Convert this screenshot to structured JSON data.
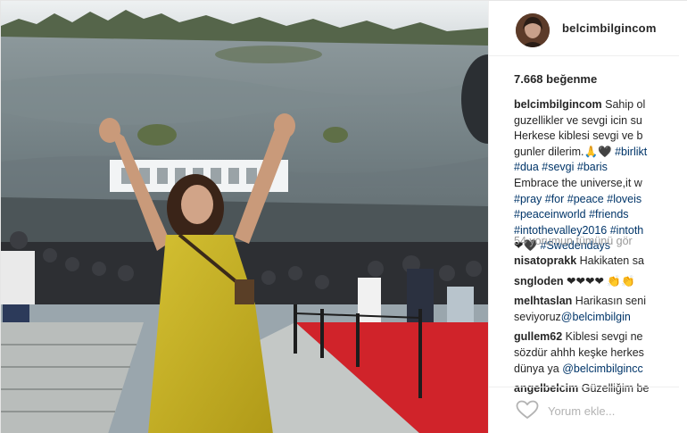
{
  "post": {
    "username": "belcimbilgincom",
    "likes": "7.668 beğenme",
    "caption_lines": [
      {
        "user": "belcimbilgincom",
        "text": " Sahip ol"
      },
      {
        "text": "guzellikler ve sevgi icin su"
      },
      {
        "text": "Herkese kiblesi sevgi ve b"
      },
      {
        "text": "gunler dilerim.🙏🖤 ",
        "tag": "#birlikt"
      },
      {
        "tag": "#dua #sevgi #baris"
      },
      {
        "text": "Embrace the universe,it w"
      },
      {
        "tag": "#pray #for #peace #loveis"
      },
      {
        "tag": "#peaceinworld #friends"
      },
      {
        "tag": "#intothevalley2016 #intoth"
      },
      {
        "text": "❤🖤 ",
        "tag": "#Swedendays"
      }
    ],
    "view_all": "54 yorumun tümünü gör",
    "comments": [
      {
        "lines": [
          {
            "user": "nisatoprakk",
            "text": " Hakikaten sa"
          }
        ]
      },
      {
        "lines": [
          {
            "user": "sngloden",
            "text": " ❤❤❤❤ 👏👏"
          }
        ]
      },
      {
        "lines": [
          {
            "user": "melhtaslan",
            "text": " Harikasın seni"
          },
          {
            "text": "seviyoruz",
            "mention": "@belcimbilgin"
          }
        ]
      },
      {
        "lines": [
          {
            "user": "gullem62",
            "text": " Kiblesi sevgi ne"
          },
          {
            "text": "sözdür ahhh keşke herkes"
          },
          {
            "text": "dünya ya ",
            "mention": "@belcimbilgincc"
          }
        ]
      },
      {
        "lines": [
          {
            "user": "angelbelcim",
            "text": " Güzelliğim be"
          }
        ]
      }
    ],
    "comment_placeholder": "Yorum ekle..."
  },
  "icons": {
    "like": "heart-outline-icon",
    "avatar": "profile-avatar"
  },
  "colors": {
    "hashtag": "#003569",
    "muted": "#999999",
    "text": "#262626",
    "dress": "#c9b428",
    "carpet": "#d0232a"
  }
}
